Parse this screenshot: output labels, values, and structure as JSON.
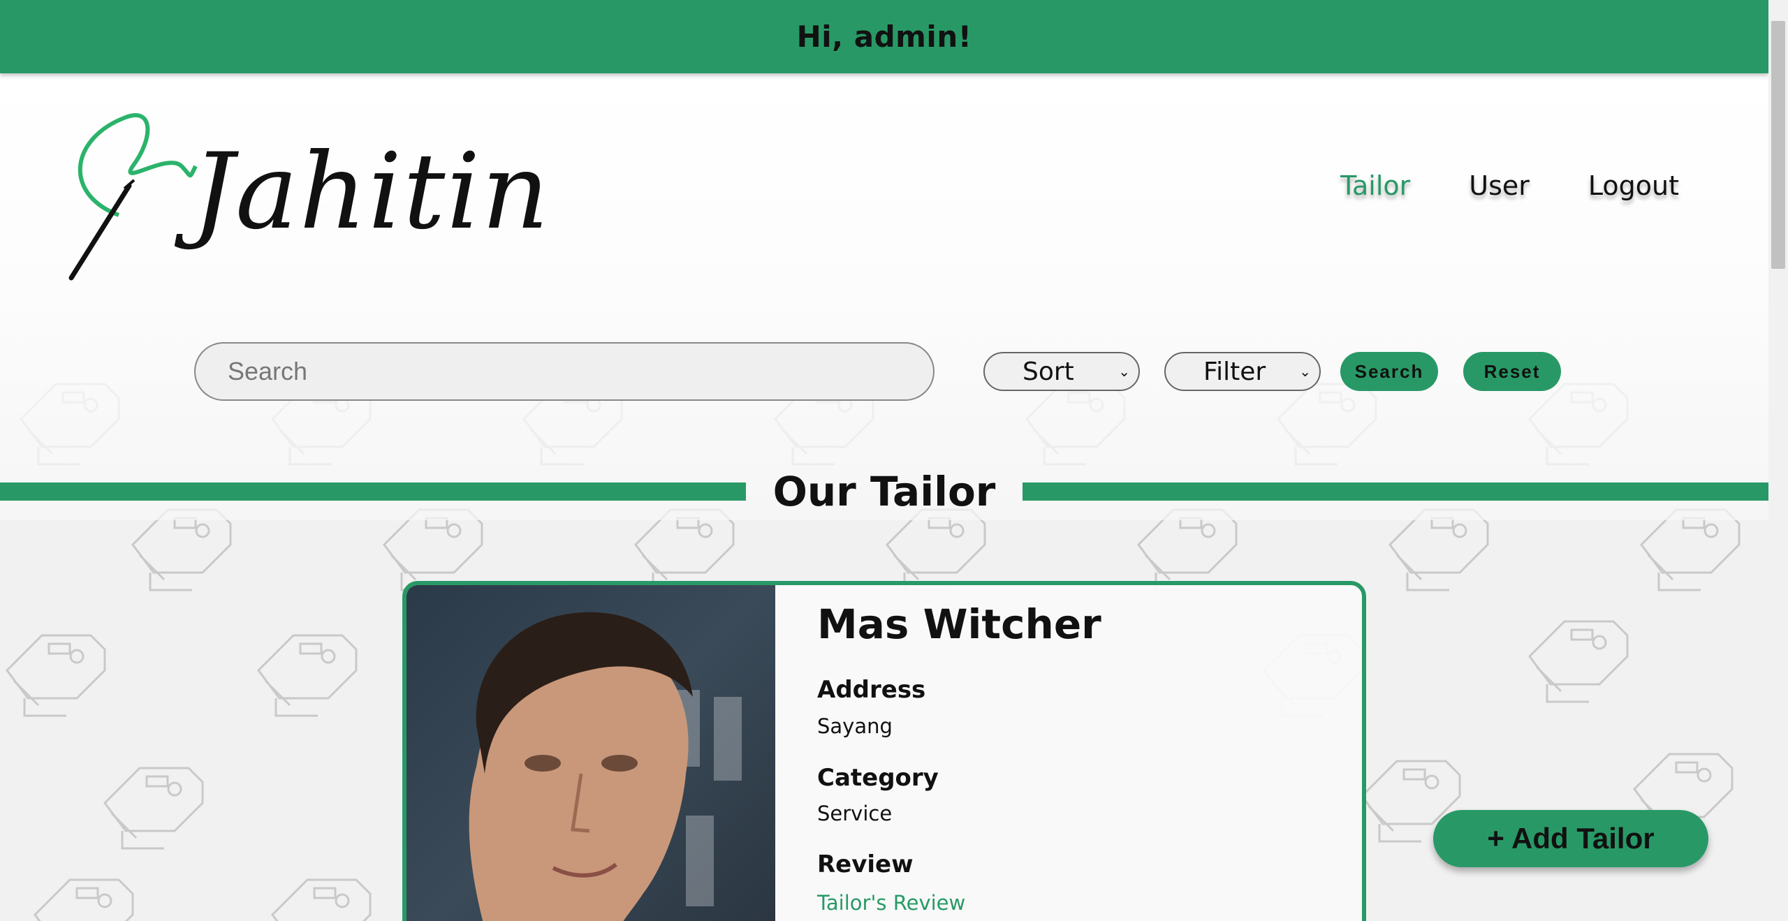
{
  "topbar": {
    "greeting": "Hi, admin!"
  },
  "brand": {
    "name": "Jahitin"
  },
  "nav": {
    "items": [
      {
        "label": "Tailor",
        "active": true
      },
      {
        "label": "User",
        "active": false
      },
      {
        "label": "Logout",
        "active": false
      }
    ]
  },
  "search": {
    "placeholder": "Search",
    "value": "",
    "sort_label": "Sort",
    "filter_label": "Filter",
    "search_button": "Search",
    "reset_button": "Reset"
  },
  "section": {
    "title": "Our Tailor"
  },
  "tailor_card": {
    "name": "Mas Witcher",
    "address_label": "Address",
    "address": "Sayang",
    "category_label": "Category",
    "category": "Service",
    "review_label": "Review",
    "review_link": "Tailor's Review"
  },
  "actions": {
    "add_tailor": "+ Add Tailor"
  },
  "colors": {
    "accent": "#289966",
    "text": "#111111",
    "background": "#f1f1f1"
  }
}
